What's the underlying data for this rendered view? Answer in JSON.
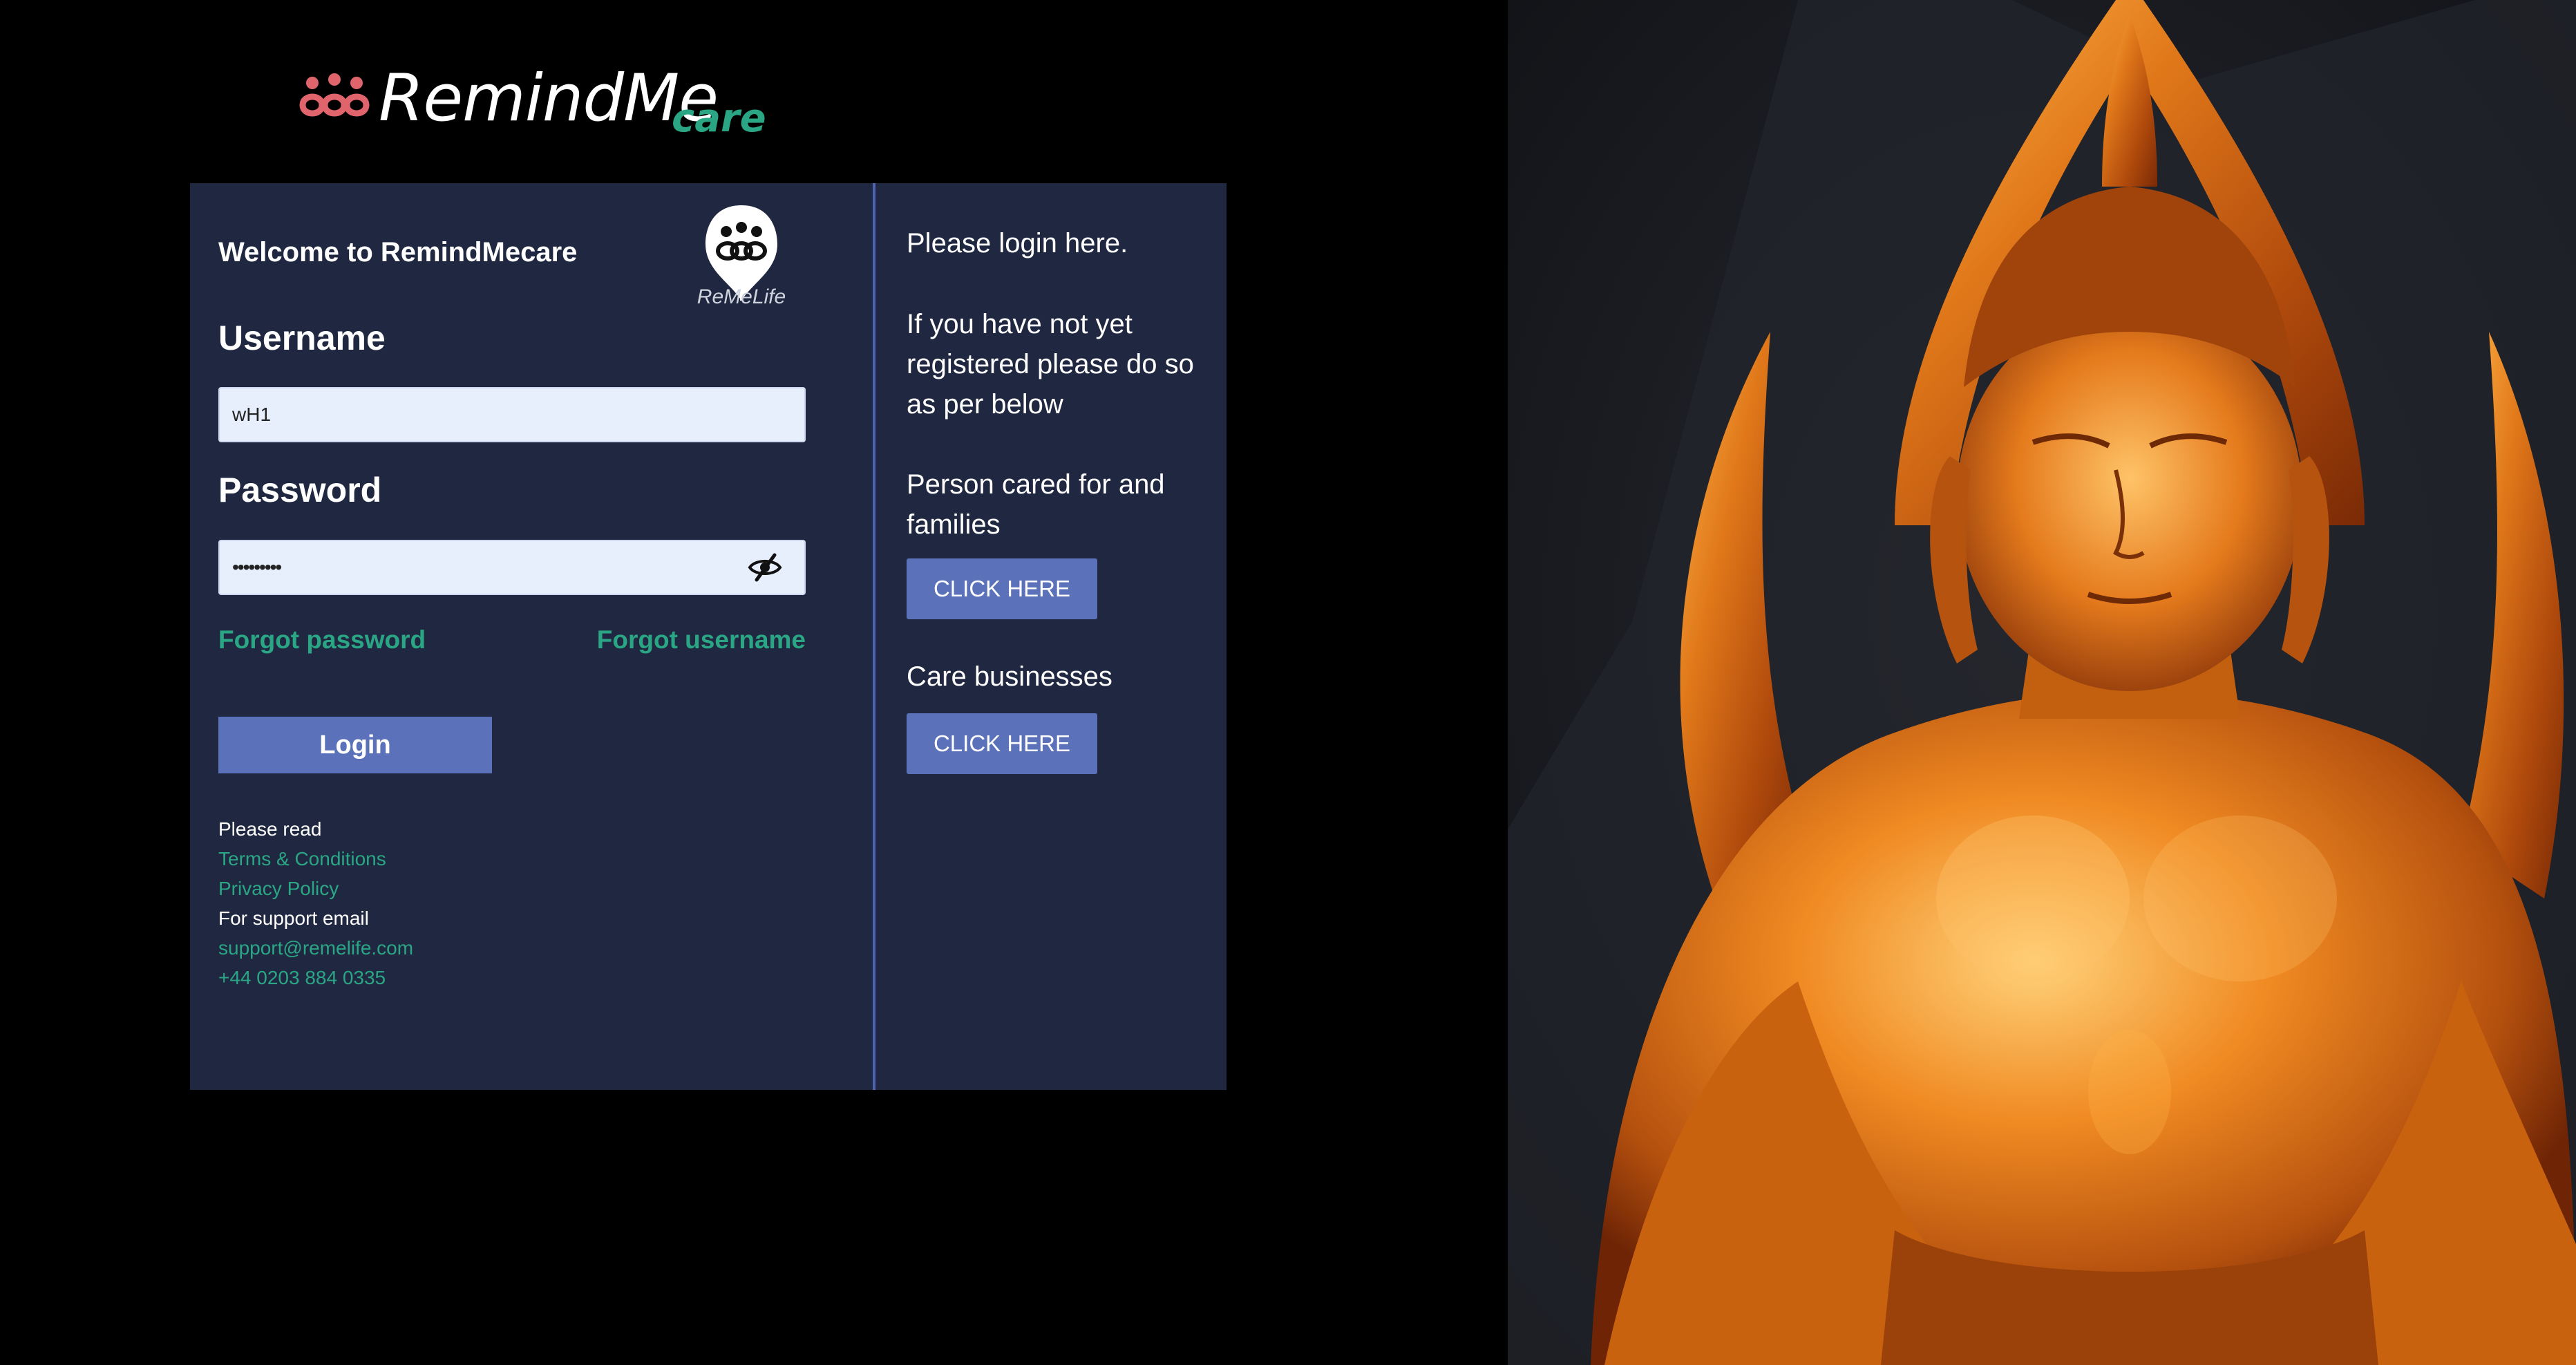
{
  "brand": {
    "name": "RemindMe",
    "suffix": "care"
  },
  "card": {
    "welcome": "Welcome to RemindMecare",
    "partner_logo_text": "ReMeLife",
    "username_label": "Username",
    "username_value": "wH1",
    "password_label": "Password",
    "password_value": "•••••••••",
    "forgot_password": "Forgot password",
    "forgot_username": "Forgot username",
    "login_button": "Login",
    "footer": {
      "please_read": "Please read",
      "terms": "Terms & Conditions",
      "privacy": "Privacy Policy",
      "support_label": "For support email",
      "support_email": "support@remelife.com",
      "phone": "+44 0203 884 0335"
    }
  },
  "register": {
    "intro": "Please login here.",
    "note": "If you have not yet registered please do so as per below",
    "person_heading": "Person cared for and families",
    "person_button": "CLICK HERE",
    "business_heading": "Care businesses",
    "business_button": "CLICK HERE"
  },
  "colors": {
    "page_background": "#000000",
    "card_background": "#202841",
    "accent_green": "#2aa685",
    "button_blue": "#5b71b9",
    "logo_coral": "#e0646b",
    "input_background": "#e7effd"
  },
  "icons": {
    "brand_mark": "family-loop-icon",
    "partner_logo": "balloon-people-icon",
    "password_toggle": "eye-slash-icon"
  }
}
